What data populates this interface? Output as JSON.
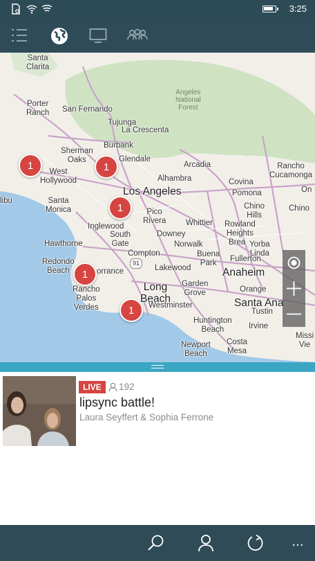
{
  "status_bar": {
    "time": "3:25",
    "battery_level": 0.85,
    "icons": [
      "notification-icon",
      "wifi-calling-icon",
      "wifi-icon",
      "battery-icon"
    ]
  },
  "nav": {
    "tabs": [
      {
        "icon": "list-icon",
        "selected": false
      },
      {
        "icon": "globe-icon",
        "selected": true
      },
      {
        "icon": "tv-icon",
        "selected": false
      },
      {
        "icon": "people-icon",
        "selected": false
      }
    ]
  },
  "map": {
    "labels": {
      "santa_clarita": "Santa\nClarita",
      "porter_ranch": "Porter\nRanch",
      "san_fernando": "San Fernando",
      "tujunga": "Tujunga",
      "la_crescenta": "La Crescenta",
      "angeles_forest": "Angeles\nNational\nForest",
      "sherman_oaks": "Sherman\nOaks",
      "burbank": "Burbank",
      "glendale": "Glendale",
      "west_hollywood": "West\nHollywood",
      "alhambra": "Alhambra",
      "arcadia": "Arcadia",
      "rancho_cucamonga": "Rancho\nCucamonga",
      "los_angeles": "Los Angeles",
      "covina": "Covina",
      "ontario": "On",
      "pomona": "Pomona",
      "santa_monica": "Santa\nMonica",
      "chino_hills": "Chino\nHills",
      "chino": "Chino",
      "libu": "libu",
      "pico_rivera": "Pico\nRivera",
      "inglewood": "Inglewood",
      "whittier": "Whittier",
      "rowland_heights": "Rowland\nHeights",
      "south_gate": "South\nGate",
      "downey": "Downey",
      "hawthorne": "Hawthorne",
      "norwalk": "Norwalk",
      "brea": "Brea",
      "yorba_linda": "Yorba\nLinda",
      "compton": "Compton",
      "buena_park": "Buena\nPark",
      "fullerton": "Fullerton",
      "hwy_91": "91",
      "redondo_beach": "Redondo\nBeach",
      "torrance": "orrance",
      "lakewood": "Lakewood",
      "anaheim": "Anaheim",
      "rancho_palos_verdes": "Rancho\nPalos\nVerdes",
      "long_beach": "Long\nBeach",
      "garden_grove": "Garden\nGrove",
      "orange": "Orange",
      "westminster": "Westminster",
      "santa_ana": "Santa Ana",
      "tustin": "Tustin",
      "huntington_beach": "Huntington\nBeach",
      "irvine": "Irvine",
      "costa_mesa": "Costa\nMesa",
      "newport_beach": "Newport\nBeach",
      "mission_viejo": "Missi\nVie"
    },
    "clusters": [
      {
        "count": "1"
      },
      {
        "count": "1"
      },
      {
        "count": "1"
      },
      {
        "count": "1"
      },
      {
        "count": "1"
      }
    ],
    "controls": [
      "locate-icon",
      "zoom-in-icon",
      "zoom-out-icon"
    ]
  },
  "stream": {
    "badge": "LIVE",
    "viewers": "192",
    "title": "lipsync battle!",
    "users": "Laura Seyffert & Sophia Ferrone"
  },
  "app_bar": {
    "buttons": [
      "search-icon",
      "profile-icon",
      "refresh-icon",
      "more-icon"
    ],
    "more_glyph": "..."
  },
  "colors": {
    "chrome": "#2f4b58",
    "accent_divider": "#3ba6c4",
    "live_red": "#d64541",
    "ocean": "#a3c9e8",
    "forest": "#cfe3c3",
    "road": "#c9a3c8"
  }
}
